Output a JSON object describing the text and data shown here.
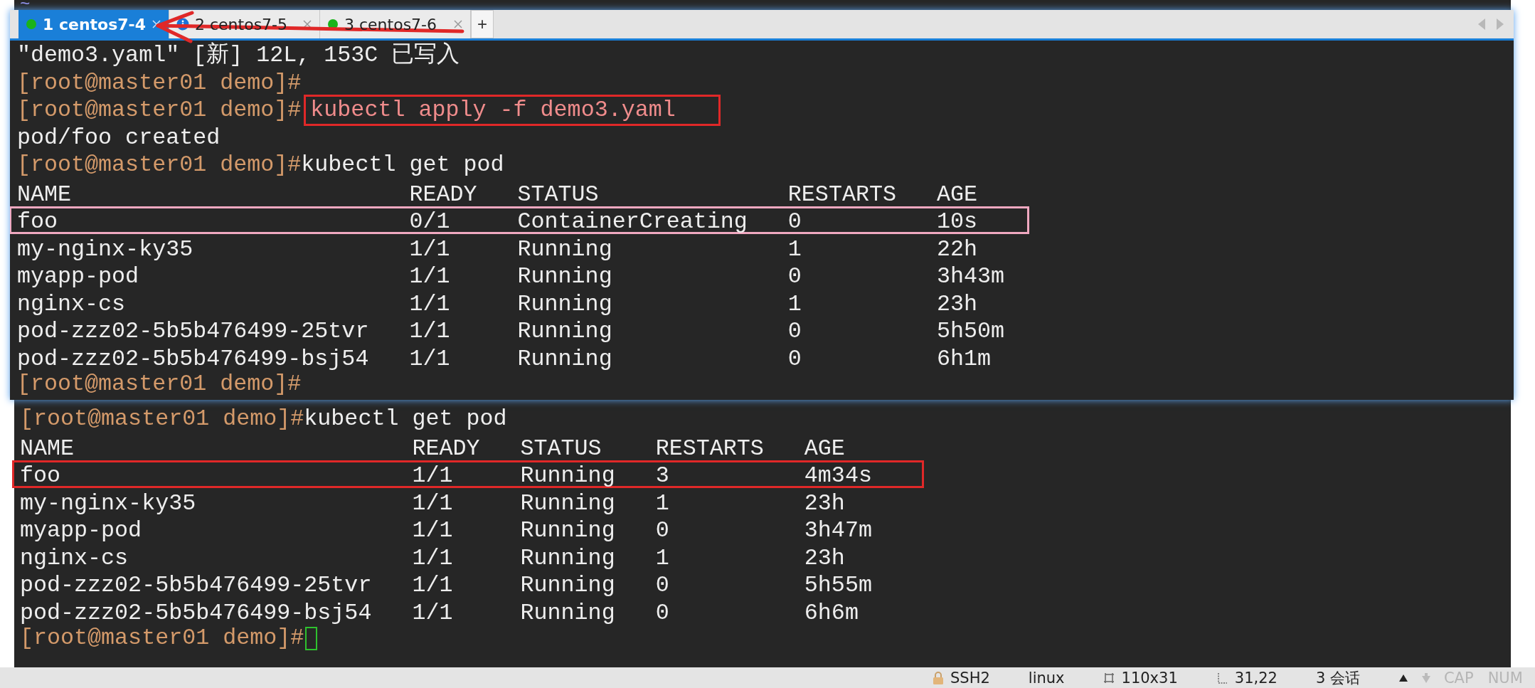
{
  "background_terminal": {
    "top_line": "~",
    "lines": [
      {
        "kind": "text",
        "segments": [
          {
            "kind": "prompt",
            "text": "[root@master01 demo]#"
          },
          {
            "kind": "plain",
            "text": "kubectl get pod"
          }
        ]
      },
      {
        "kind": "table",
        "columns": [
          "NAME",
          "READY",
          "STATUS",
          "RESTARTS",
          "AGE"
        ],
        "rows": [
          {
            "cells": [
              "foo",
              "1/1",
              "Running",
              "3",
              "4m34s"
            ],
            "highlighted": true,
            "color": "#e02828"
          },
          {
            "cells": [
              "my-nginx-ky35",
              "1/1",
              "Running",
              "1",
              "23h"
            ],
            "highlighted": false
          },
          {
            "cells": [
              "myapp-pod",
              "1/1",
              "Running",
              "0",
              "3h47m"
            ],
            "highlighted": false
          },
          {
            "cells": [
              "nginx-cs",
              "1/1",
              "Running",
              "1",
              "23h"
            ],
            "highlighted": false
          },
          {
            "cells": [
              "pod-zzz02-5b5b476499-25tvr",
              "1/1",
              "Running",
              "0",
              "5h55m"
            ],
            "highlighted": false
          },
          {
            "cells": [
              "pod-zzz02-5b5b476499-bsj54",
              "1/1",
              "Running",
              "0",
              "6h6m"
            ],
            "highlighted": false
          }
        ]
      },
      {
        "kind": "text",
        "segments": [
          {
            "kind": "prompt",
            "text": "[root@master01 demo]#"
          }
        ],
        "cursor": true
      }
    ]
  },
  "window": {
    "tabs": [
      {
        "label": "1 centos7-4",
        "selected": true,
        "kind": "connected"
      },
      {
        "label": "2 centos7-5",
        "selected": false,
        "kind": "info"
      },
      {
        "label": "3 centos7-6",
        "selected": false,
        "kind": "connected"
      }
    ],
    "new_tab": "+",
    "lines": [
      {
        "kind": "text",
        "segments": [
          {
            "kind": "plain",
            "text": "\"demo3.yaml\" [新] 12L, 153C 已写入"
          }
        ]
      },
      {
        "kind": "text",
        "segments": [
          {
            "kind": "prompt",
            "text": "[root@master01 demo]#"
          }
        ]
      },
      {
        "kind": "text",
        "segments": [
          {
            "kind": "prompt",
            "text": "[root@master01 demo]#"
          },
          {
            "kind": "command",
            "text": "kubectl apply -f demo3.yaml",
            "highlighted": true,
            "color": "#e02828"
          }
        ]
      },
      {
        "kind": "text",
        "segments": [
          {
            "kind": "plain",
            "text": "pod/foo created"
          }
        ]
      },
      {
        "kind": "text",
        "segments": [
          {
            "kind": "prompt",
            "text": "[root@master01 demo]#"
          },
          {
            "kind": "plain",
            "text": "kubectl get pod"
          }
        ]
      },
      {
        "kind": "table",
        "columns": [
          "NAME",
          "READY",
          "STATUS",
          "RESTARTS",
          "AGE"
        ],
        "rows": [
          {
            "cells": [
              "foo",
              "0/1",
              "ContainerCreating",
              "0",
              "10s"
            ],
            "highlighted": true,
            "color": "#f0a8c0"
          },
          {
            "cells": [
              "my-nginx-ky35",
              "1/1",
              "Running",
              "1",
              "22h"
            ],
            "highlighted": false
          },
          {
            "cells": [
              "myapp-pod",
              "1/1",
              "Running",
              "0",
              "3h43m"
            ],
            "highlighted": false
          },
          {
            "cells": [
              "nginx-cs",
              "1/1",
              "Running",
              "1",
              "23h"
            ],
            "highlighted": false
          },
          {
            "cells": [
              "pod-zzz02-5b5b476499-25tvr",
              "1/1",
              "Running",
              "0",
              "5h50m"
            ],
            "highlighted": false
          },
          {
            "cells": [
              "pod-zzz02-5b5b476499-bsj54",
              "1/1",
              "Running",
              "0",
              "6h1m"
            ],
            "highlighted": false
          }
        ]
      },
      {
        "kind": "text",
        "segments": [
          {
            "kind": "prompt",
            "text": "[root@master01 demo]#"
          }
        ]
      }
    ]
  },
  "status_bar": {
    "items": [
      {
        "kind": "lock",
        "text": "SSH2"
      },
      {
        "kind": "plain",
        "text": "linux"
      },
      {
        "kind": "size",
        "text": "110x31"
      },
      {
        "kind": "cursor",
        "text": "31,22"
      },
      {
        "kind": "plain",
        "text": "3 会话"
      }
    ],
    "toggles": [
      {
        "text": "CAP",
        "active": false
      },
      {
        "text": "NUM",
        "active": false
      }
    ]
  }
}
